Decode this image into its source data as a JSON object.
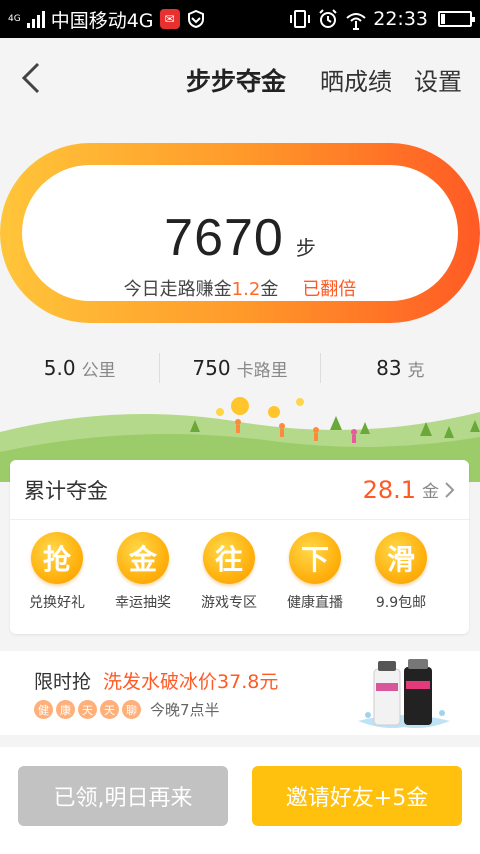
{
  "status_bar": {
    "network_small": "4G",
    "carrier": "中国移动4G",
    "time": "22:33"
  },
  "nav": {
    "title": "步步夺金",
    "share_label": "晒成绩",
    "settings_label": "设置"
  },
  "steps": {
    "count": "7670",
    "unit": "步",
    "earn_prefix": "今日走路赚金",
    "earn_amount": "1.2",
    "earn_suffix": "金",
    "doubled_label": "已翻倍"
  },
  "stats": [
    {
      "value": "5.0",
      "unit": "公里"
    },
    {
      "value": "750",
      "unit": "卡路里"
    },
    {
      "value": "83",
      "unit": "克"
    }
  ],
  "card": {
    "title": "累计夺金",
    "total": "28.1",
    "total_unit": "金",
    "items": [
      {
        "icon_char": "抢",
        "label": "兑换好礼"
      },
      {
        "icon_char": "金",
        "label": "幸运抽奖"
      },
      {
        "icon_char": "往",
        "label": "游戏专区"
      },
      {
        "icon_char": "下",
        "label": "健康直播"
      },
      {
        "icon_char": "滑",
        "label": "9.9包邮"
      }
    ]
  },
  "promo": {
    "tag": "限时抢",
    "deal": "洗发水破冰价37.8元",
    "badges": [
      "健",
      "康",
      "天",
      "天",
      "聊"
    ],
    "time": "今晚7点半"
  },
  "buttons": {
    "claimed_label": "已领,明日再来",
    "invite_label": "邀请好友+5金"
  },
  "colors": {
    "accent": "#ff5a24",
    "gold": "#ffc10e",
    "disabled": "#c2c2c2"
  }
}
